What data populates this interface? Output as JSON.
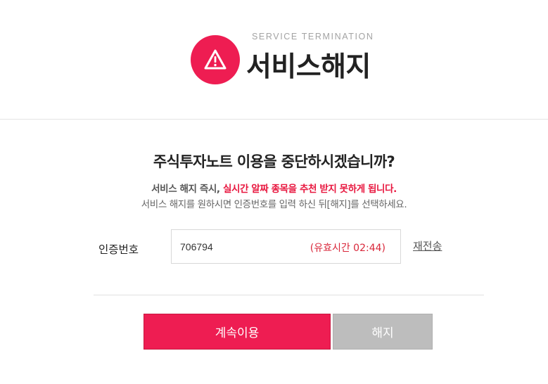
{
  "header": {
    "eyebrow": "SERVICE TERMINATION",
    "title": "서비스해지",
    "icon": "warning-triangle-icon",
    "accent_color": "#ee1d52"
  },
  "main": {
    "question": "주식투자노트 이용을 중단하시겠습니까?",
    "notice_prefix": "서비스 해지 즉시, ",
    "notice_warning": "실시간 알짜 종목을 추천 받지 못하게 됩니다.",
    "instruction": "서비스 해지를 원하시면 인증번호를 입력 하신 뒤[해지]를 선택하세요."
  },
  "auth": {
    "label": "인증번호",
    "value": "706794",
    "timer": "(유효시간 02:44)",
    "resend_label": "재전송"
  },
  "buttons": {
    "continue_label": "계속이용",
    "cancel_label": "해지"
  }
}
